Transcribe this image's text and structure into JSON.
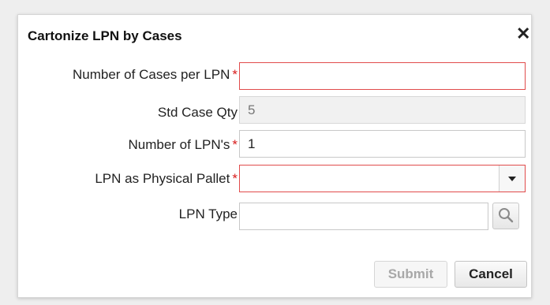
{
  "dialog": {
    "title": "Cartonize LPN by Cases",
    "close_label": "✕"
  },
  "fields": {
    "cases_per_lpn": {
      "label": "Number of Cases per LPN",
      "required_mark": "*",
      "value": ""
    },
    "std_case_qty": {
      "label": "Std Case Qty",
      "value": "5"
    },
    "number_of_lpns": {
      "label": "Number of LPN's",
      "required_mark": "*",
      "value": "1"
    },
    "lpn_as_physical_pallet": {
      "label": "LPN as Physical Pallet",
      "required_mark": "*",
      "selected": ""
    },
    "lpn_type": {
      "label": "LPN Type",
      "value": ""
    }
  },
  "buttons": {
    "submit": "Submit",
    "cancel": "Cancel"
  },
  "icons": {
    "close": "close-icon",
    "dropdown": "chevron-down-icon",
    "lookup": "search-icon"
  },
  "colors": {
    "required": "#d81c1c",
    "required_border": "#e14b4b"
  }
}
